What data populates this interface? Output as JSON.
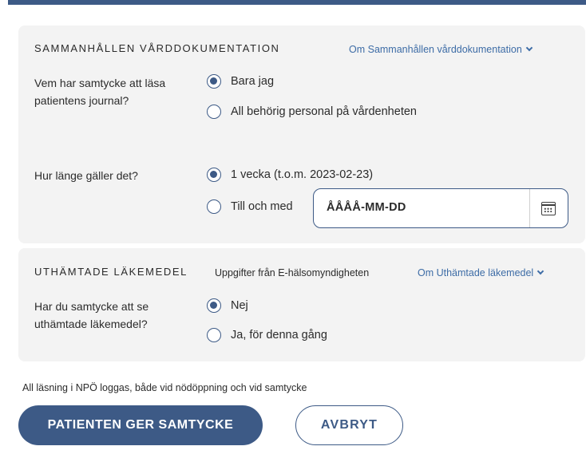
{
  "section1": {
    "title": "SAMMANHÅLLEN VÅRDDOKUMENTATION",
    "about_link": "Om Sammanhållen vårddokumentation",
    "consent_question": "Vem har samtycke att läsa patientens journal?",
    "consent_options": [
      {
        "label": "Bara jag",
        "checked": true
      },
      {
        "label": "All behörig personal på vårdenheten",
        "checked": false
      }
    ],
    "duration_question": "Hur länge gäller det?",
    "duration_options": [
      {
        "label": "1 vecka (t.o.m. 2023-02-23)",
        "checked": true
      },
      {
        "label": "Till och med",
        "checked": false
      }
    ],
    "date_placeholder": "ÅÅÅÅ-MM-DD"
  },
  "section2": {
    "title": "UTHÄMTADE LÄKEMEDEL",
    "source_info": "Uppgifter från E-hälsomyndigheten",
    "about_link": "Om Uthämtade läkemedel",
    "question": "Har du samtycke att se uthämtade läkemedel?",
    "options": [
      {
        "label": "Nej",
        "checked": true
      },
      {
        "label": "Ja, för denna gång",
        "checked": false
      }
    ]
  },
  "footer": {
    "note": "All läsning i NPÖ loggas, både vid nödöppning och vid samtycke",
    "primary_button": "PATIENTEN GER SAMTYCKE",
    "secondary_button": "AVBRYT"
  },
  "colors": {
    "accent": "#3d5a86",
    "link": "#3d6ca6",
    "panel_bg": "#f3f3f3"
  }
}
